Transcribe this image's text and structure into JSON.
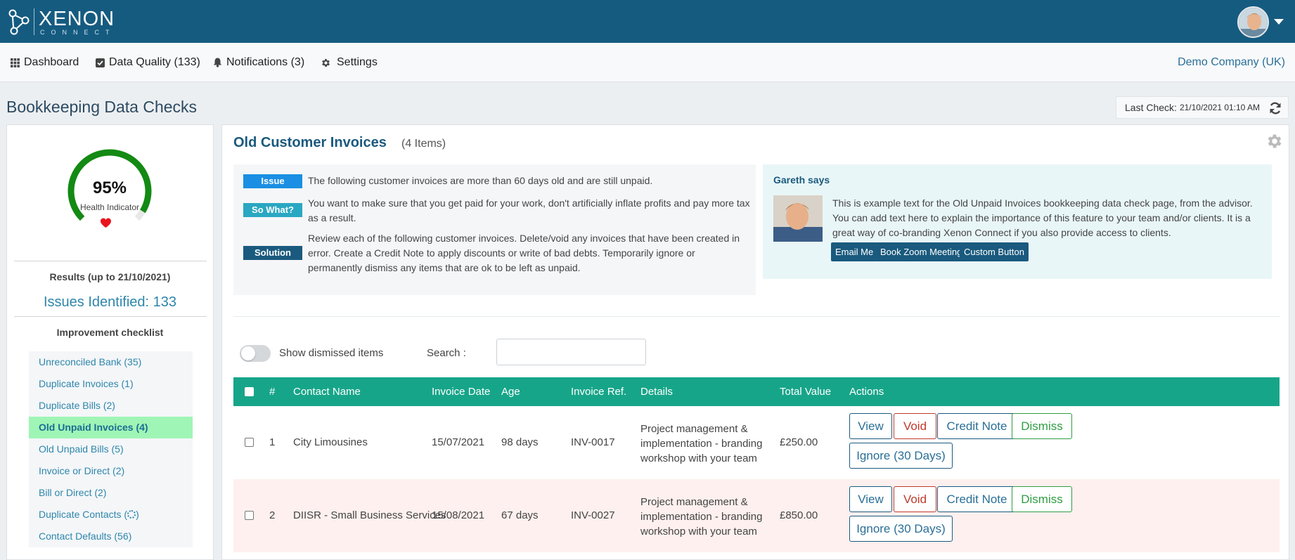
{
  "app": {
    "logo_main": "XENON",
    "logo_sub": "CONNECT"
  },
  "nav": {
    "items": [
      {
        "label": "Dashboard",
        "icon": "grid-icon"
      },
      {
        "label": "Data Quality (133)",
        "icon": "checkbox-icon"
      },
      {
        "label": "Notifications (3)",
        "icon": "bell-icon"
      },
      {
        "label": "Settings",
        "icon": "gear-icon"
      }
    ],
    "company": "Demo Company (UK)"
  },
  "page": {
    "title": "Bookkeeping Data Checks",
    "last_check_label": "Last Check:",
    "last_check_value": "21/10/2021 01:10 AM"
  },
  "health": {
    "percent_label": "95%",
    "percent_value": 0.95,
    "indicator_label": "Health Indicator",
    "results_label": "Results (up to 21/10/2021)",
    "issues_label": "Issues Identified: 133",
    "checklist_title": "Improvement checklist",
    "checklist": [
      {
        "label": "Unreconciled Bank (35)",
        "active": false
      },
      {
        "label": "Duplicate Invoices (1)",
        "active": false
      },
      {
        "label": "Duplicate Bills (2)",
        "active": false
      },
      {
        "label": "Old Unpaid Invoices (4)",
        "active": true
      },
      {
        "label": "Old Unpaid Bills (5)",
        "active": false
      },
      {
        "label": "Invoice or Direct (2)",
        "active": false
      },
      {
        "label": "Bill or Direct (2)",
        "active": false
      },
      {
        "label": "Duplicate Contacts (",
        "suffix": ")",
        "loading": true,
        "active": false
      },
      {
        "label": "Contact Defaults (56)",
        "active": false
      }
    ]
  },
  "main": {
    "title": "Old Customer Invoices",
    "count": "(4 Items)",
    "info": [
      {
        "tag": "Issue",
        "text": "The following customer invoices are more than 60 days old and are still unpaid."
      },
      {
        "tag": "So What?",
        "text": "You want to make sure that you get paid for your work, don't artificially inflate profits and pay more tax as a result."
      },
      {
        "tag": "Solution",
        "text": "Review each of the following customer invoices. Delete/void any invoices that have been created in error. Create a Credit Note to apply discounts or write of bad debts. Temporarily ignore or permanently dismiss any items that are ok to be left as unpaid."
      }
    ],
    "advisor": {
      "title": "Gareth says",
      "text": "This is example text for the Old Unpaid Invoices bookkeeping data check page, from the advisor. You can add text here to explain the importance of this feature to your team and/or clients. It is a great way of co-branding Xenon Connect if you also provide access to clients.",
      "buttons": [
        "Email Me",
        "Book Zoom Meeting",
        "Custom Button"
      ]
    },
    "show_dismissed_label": "Show dismissed items",
    "search_label": "Search :",
    "search_value": "",
    "table": {
      "headers": [
        "#",
        "Contact Name",
        "Invoice Date",
        "Age",
        "Invoice Ref.",
        "Details",
        "Total Value",
        "Actions"
      ],
      "rows": [
        {
          "num": "1",
          "contact": "City Limousines",
          "date": "15/07/2021",
          "age": "98 days",
          "ref": "INV-0017",
          "details": "Project management & implementation - branding workshop with your team",
          "total": "£250.00"
        },
        {
          "num": "2",
          "contact": "DIISR - Small Business Services",
          "date": "15/08/2021",
          "age": "67 days",
          "ref": "INV-0027",
          "details": "Project management & implementation - branding workshop with your team",
          "total": "£850.00"
        }
      ],
      "actions": {
        "view": "View",
        "void": "Void",
        "credit_note": "Credit Note",
        "dismiss": "Dismiss",
        "ignore": "Ignore (30 Days)"
      }
    }
  },
  "colors": {
    "topbar": "#155b80",
    "table_header": "#17a589",
    "gauge_good": "#138a13",
    "active_item": "#9ff5b5",
    "heart": "#e8141e"
  }
}
